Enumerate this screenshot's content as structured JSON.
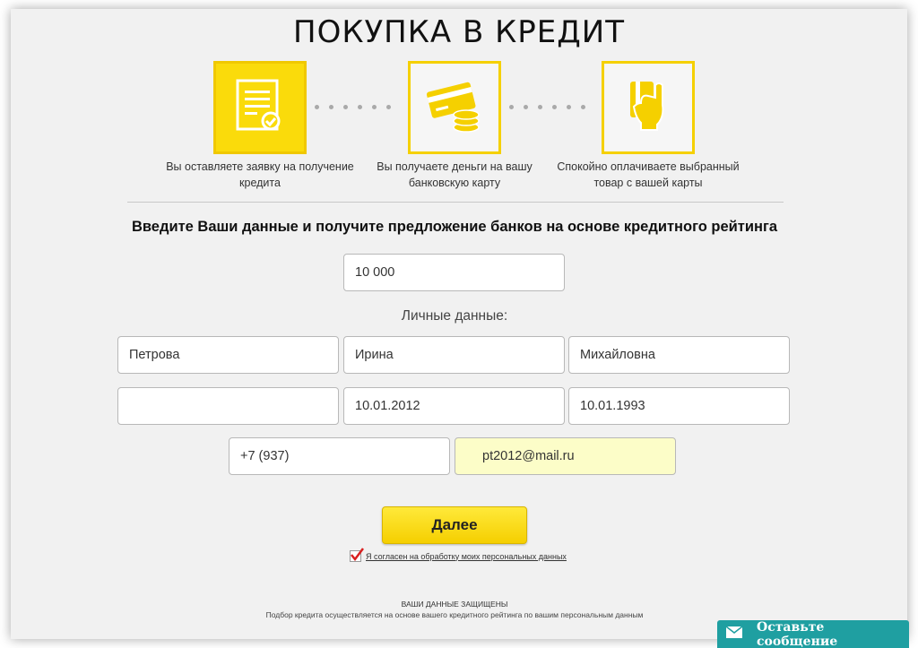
{
  "page": {
    "title": "ПОКУПКА В КРЕДИТ"
  },
  "steps": [
    {
      "label": "Вы оставляете заявку на получение кредита",
      "icon": "application-form-icon",
      "active": true
    },
    {
      "label": "Вы получаете деньги на вашу банковскую карту",
      "icon": "card-coins-icon",
      "active": false
    },
    {
      "label": "Спокойно оплачиваете выбранный товар с вашей карты",
      "icon": "hand-card-icon",
      "active": false
    }
  ],
  "form": {
    "heading": "Введите Ваши данные и получите предложение банков на основе кредитного рейтинга",
    "amount": "10 000",
    "personal_label": "Личные данные:",
    "last_name": "Петрова",
    "first_name": "Ирина",
    "middle_name": "Михайловна",
    "empty_field": "",
    "date_1": "10.01.2012",
    "date_2": "10.01.1993",
    "phone": "+7 (937)",
    "email": "pt2012@mail.ru",
    "next_label": "Далее",
    "consent": "Я согласен на обработку моих персональных данных"
  },
  "footer": {
    "secure_title": "ВАШИ ДАННЫЕ ЗАЩИЩЕНЫ",
    "secure_sub": "Подбор кредита осуществляется на основе вашего кредитного рейтинга по вашим персональным данным"
  },
  "chat": {
    "label": "Оставьте сообщение"
  },
  "colors": {
    "accent": "#fadb0b",
    "chat": "#1f9fa1",
    "highlight": "#fcfdc8"
  }
}
